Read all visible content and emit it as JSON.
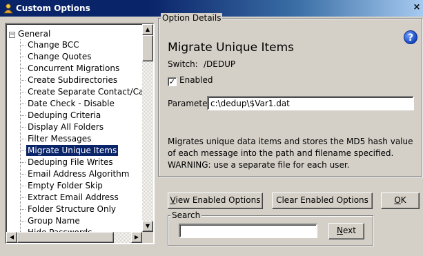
{
  "window": {
    "title": "Custom Options",
    "close_glyph": "×",
    "icon": "person-icon"
  },
  "tree": {
    "root_label": "General",
    "expander_glyph": "−",
    "items": [
      {
        "label": "Change BCC"
      },
      {
        "label": "Change Quotes"
      },
      {
        "label": "Concurrent Migrations"
      },
      {
        "label": "Create Subdirectories"
      },
      {
        "label": "Create Separate Contact/Cale"
      },
      {
        "label": "Date Check - Disable"
      },
      {
        "label": "Deduping Criteria"
      },
      {
        "label": "Display All Folders"
      },
      {
        "label": "Filter Messages"
      },
      {
        "label": "Migrate Unique Items"
      },
      {
        "label": "Deduping File Writes"
      },
      {
        "label": "Email Address Algorithm"
      },
      {
        "label": "Empty Folder Skip"
      },
      {
        "label": "Extract Email Address"
      },
      {
        "label": "Folder Structure Only"
      },
      {
        "label": "Group Name"
      },
      {
        "label": "Hide Passwords"
      }
    ],
    "selected_index": 9
  },
  "details": {
    "group_label": "Option Details",
    "help_glyph": "?",
    "option_title": "Migrate Unique Items",
    "switch_label": "Switch:",
    "switch_value": "/DEDUP",
    "enabled_label": "Enabled",
    "enabled_checked": true,
    "check_glyph": "✓",
    "parameter_label": "Parameter:",
    "parameter_value": "c:\\dedup\\$Var1.dat",
    "description": "Migrates unique data items and stores the MD5 hash value of each message into the path and filename specified.  WARNING: use a separate file for each user."
  },
  "buttons": {
    "view_enabled_first": "V",
    "view_enabled_rest": "iew Enabled Options",
    "clear_enabled": "Clear Enabled Options",
    "ok_first": "O",
    "ok_rest": "K"
  },
  "search": {
    "group_label": "Search",
    "value": "",
    "next_first": "N",
    "next_rest": "ext"
  },
  "scroll": {
    "up_glyph": "▲",
    "down_glyph": "▼",
    "left_glyph": "◀",
    "right_glyph": "▶"
  }
}
